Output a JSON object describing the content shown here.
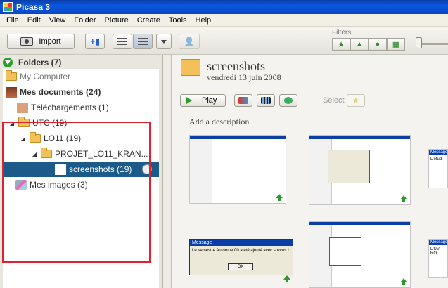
{
  "window": {
    "title": "Picasa 3"
  },
  "menu": [
    "File",
    "Edit",
    "View",
    "Folder",
    "Picture",
    "Create",
    "Tools",
    "Help"
  ],
  "toolbar": {
    "import_label": "Import",
    "filters_label": "Filters"
  },
  "sidebar": {
    "header": "Folders (7)",
    "items": [
      {
        "label": "My Computer",
        "icon": "folder-icon"
      },
      {
        "label": "Mes documents (24)",
        "icon": "avatar-icon"
      },
      {
        "label": "Téléchargements (1)",
        "icon": "downloads-icon"
      },
      {
        "label": "UTC (19)",
        "icon": "folder-icon"
      },
      {
        "label": "LO11 (19)",
        "icon": "folder-icon"
      },
      {
        "label": "PROJET_LO11_KRAN...",
        "icon": "folder-icon"
      },
      {
        "label": "screenshots (19)",
        "icon": "thumbnail-icon",
        "selected": true
      },
      {
        "label": "Mes images (3)",
        "icon": "images-icon"
      }
    ]
  },
  "album": {
    "title": "screenshots",
    "date": "vendredi 13 juin 2008",
    "play_label": "Play",
    "select_label": "Select",
    "description_placeholder": "Add a description"
  },
  "thumbnails": {
    "dialog_title": "Message",
    "dialog_message": "Le semestre  Automne 00 a été ajouté avec succès !",
    "ok_label": "OK",
    "partial_text_1": "L'étudi",
    "partial_text_2": "L'UV RO"
  },
  "colors": {
    "selection": "#1c5a8a",
    "annotation": "#e0202a",
    "accent": "#2e9a2e"
  }
}
